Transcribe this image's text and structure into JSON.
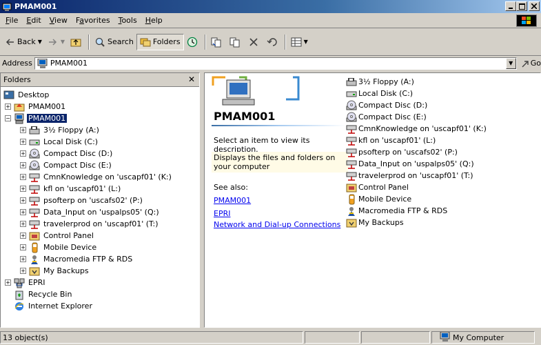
{
  "window": {
    "title": "PMAM001"
  },
  "menubar": {
    "items": [
      {
        "key": "F",
        "rest": "ile"
      },
      {
        "key": "E",
        "rest": "dit"
      },
      {
        "key": "V",
        "rest": "iew"
      },
      {
        "key": "a",
        "pre": "F",
        "rest": "vorites"
      },
      {
        "key": "T",
        "rest": "ools"
      },
      {
        "key": "H",
        "rest": "elp"
      }
    ]
  },
  "toolbar": {
    "back": "Back",
    "search": "Search",
    "folders": "Folders"
  },
  "address": {
    "label": "Address",
    "value": "PMAM001",
    "go": "Go"
  },
  "folders_pane": {
    "header": "Folders",
    "close": "✕",
    "tree": [
      {
        "label": "Desktop",
        "level": 0,
        "icon": "desktop-icon",
        "exp": ""
      },
      {
        "label": "PMAM001",
        "level": 1,
        "icon": "my-documents-icon",
        "exp": "+"
      },
      {
        "label": "PMAM001",
        "level": 1,
        "icon": "my-computer-icon",
        "exp": "-",
        "selected": true
      },
      {
        "label": "3½ Floppy (A:)",
        "level": 2,
        "icon": "floppy-icon",
        "exp": "+"
      },
      {
        "label": "Local Disk (C:)",
        "level": 2,
        "icon": "harddisk-icon",
        "exp": "+"
      },
      {
        "label": "Compact Disc (D:)",
        "level": 2,
        "icon": "cd-icon",
        "exp": "+"
      },
      {
        "label": "Compact Disc (E:)",
        "level": 2,
        "icon": "cd-icon",
        "exp": "+"
      },
      {
        "label": "CmnKnowledge on 'uscapf01' (K:)",
        "level": 2,
        "icon": "network-drive-icon",
        "exp": "+"
      },
      {
        "label": "kfl on 'uscapf01' (L:)",
        "level": 2,
        "icon": "network-drive-icon",
        "exp": "+"
      },
      {
        "label": "psofterp on 'uscafs02' (P:)",
        "level": 2,
        "icon": "network-drive-icon",
        "exp": "+"
      },
      {
        "label": "Data_Input on 'uspalps05' (Q:)",
        "level": 2,
        "icon": "network-drive-icon",
        "exp": "+"
      },
      {
        "label": "travelerprod on 'uscapf01' (T:)",
        "level": 2,
        "icon": "network-drive-icon",
        "exp": "+"
      },
      {
        "label": "Control Panel",
        "level": 2,
        "icon": "control-panel-icon",
        "exp": "+"
      },
      {
        "label": "Mobile Device",
        "level": 2,
        "icon": "mobile-device-icon",
        "exp": "+"
      },
      {
        "label": "Macromedia FTP & RDS",
        "level": 2,
        "icon": "macromedia-icon",
        "exp": "+"
      },
      {
        "label": "My Backups",
        "level": 2,
        "icon": "backups-icon",
        "exp": "+"
      },
      {
        "label": "EPRI",
        "level": 1,
        "icon": "network-places-icon",
        "exp": "+"
      },
      {
        "label": "Recycle Bin",
        "level": 1,
        "icon": "recycle-bin-icon",
        "exp": ""
      },
      {
        "label": "Internet Explorer",
        "level": 1,
        "icon": "internet-explorer-icon",
        "exp": ""
      }
    ]
  },
  "webview": {
    "title": "PMAM001",
    "select_text": "Select an item to view its description.",
    "desc": "Displays the files and folders on your computer",
    "see_also": "See also:",
    "links": [
      "PMAM001",
      "EPRI",
      "Network and Dial-up Connections"
    ]
  },
  "items": [
    {
      "label": "3½ Floppy (A:)",
      "icon": "floppy-icon"
    },
    {
      "label": "Local Disk (C:)",
      "icon": "harddisk-icon"
    },
    {
      "label": "Compact Disc (D:)",
      "icon": "cd-icon"
    },
    {
      "label": "Compact Disc (E:)",
      "icon": "cd-icon"
    },
    {
      "label": "CmnKnowledge on 'uscapf01' (K:)",
      "icon": "network-drive-icon"
    },
    {
      "label": "kfl on 'uscapf01' (L:)",
      "icon": "network-drive-icon"
    },
    {
      "label": "psofterp on 'uscafs02' (P:)",
      "icon": "network-drive-icon"
    },
    {
      "label": "Data_Input on 'uspalps05' (Q:)",
      "icon": "network-drive-icon"
    },
    {
      "label": "travelerprod on 'uscapf01' (T:)",
      "icon": "network-drive-icon"
    },
    {
      "label": "Control Panel",
      "icon": "control-panel-icon"
    },
    {
      "label": "Mobile Device",
      "icon": "mobile-device-icon"
    },
    {
      "label": "Macromedia FTP & RDS",
      "icon": "macromedia-icon"
    },
    {
      "label": "My Backups",
      "icon": "backups-icon"
    }
  ],
  "status": {
    "count": "13 object(s)",
    "zone": "My Computer"
  },
  "colors": {
    "title_active": "#0a246a",
    "selection": "#0a246a",
    "face": "#d4d0c8",
    "link": "#0000ee"
  }
}
